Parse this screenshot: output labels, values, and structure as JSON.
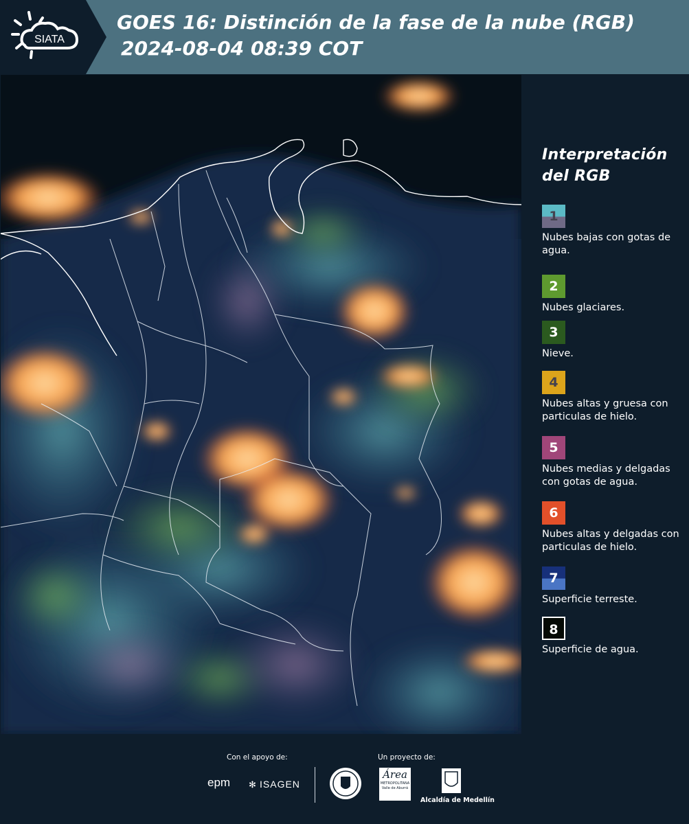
{
  "header": {
    "logo_text": "SIATA",
    "title_line1": "GOES 16: Distinción de la fase de la nube (RGB)",
    "title_line2": "2024-08-04 08:39 COT"
  },
  "legend": {
    "title_line1": "Interpretación",
    "title_line2": "del RGB",
    "items": [
      {
        "num": "1",
        "label": "Nubes bajas con gotas de agua.",
        "color_top": "#5bbac5",
        "color_bottom": "#6f6a86"
      },
      {
        "num": "2",
        "label": "Nubes glaciares.",
        "color_top": "#5e9a2f",
        "color_bottom": "#5e9a2f"
      },
      {
        "num": "3",
        "label": "Nieve.",
        "color_top": "#2b5a1f",
        "color_bottom": "#2b5a1f"
      },
      {
        "num": "4",
        "label": "Nubes altas y gruesa con particulas de hielo.",
        "color_top": "#dca41b",
        "color_bottom": "#dca41b"
      },
      {
        "num": "5",
        "label": "Nubes medias y delgadas con gotas de agua.",
        "color_top": "#a04679",
        "color_bottom": "#a04679"
      },
      {
        "num": "6",
        "label": "Nubes altas y delgadas con particulas de hielo.",
        "color_top": "#e2502a",
        "color_bottom": "#e2502a"
      },
      {
        "num": "7",
        "label": "Superficie terreste.",
        "color_top": "#17307a",
        "color_bottom": "#4a75c4"
      },
      {
        "num": "8",
        "label": "Superficie de agua.",
        "color_top": "#050a05",
        "color_bottom": "#050a05"
      }
    ]
  },
  "footer": {
    "support_label": "Con el apoyo de:",
    "project_label": "Un proyecto de:",
    "sponsor1": "epm",
    "sponsor2": "ISAGEN",
    "org1_text": "Área",
    "org1_sub1": "METROPOLITANA",
    "org1_sub2": "Valle de Aburrá",
    "org2_text": "Alcaldía de Medellín"
  }
}
